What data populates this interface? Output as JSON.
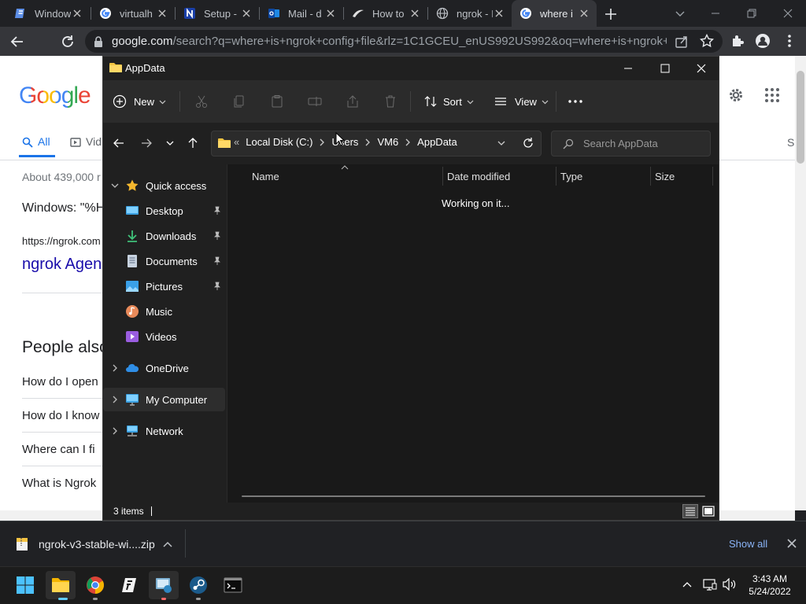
{
  "browser": {
    "tabs": [
      {
        "title": "Window",
        "favicon": "edge-doc-icon"
      },
      {
        "title": "virtualh",
        "favicon": "google-icon"
      },
      {
        "title": "Setup -",
        "favicon": "notion-icon"
      },
      {
        "title": "Mail - d",
        "favicon": "outlook-icon"
      },
      {
        "title": "How to",
        "favicon": "swoosh-icon"
      },
      {
        "title": "ngrok - I",
        "favicon": "globe-icon"
      },
      {
        "title": "where i",
        "favicon": "google-icon"
      }
    ],
    "url_host": "google.com",
    "url_path": "/search?q=where+is+ngrok+config+file&rlz=1C1GCEU_enUS992US992&oq=where+is+ngrok+conf..."
  },
  "google": {
    "logo": "Google",
    "tab_all": "All",
    "tab_videos": "Vid",
    "results_count": "About 439,000 r",
    "snippet_windows": "Windows: \"%H",
    "result_url": "https://ngrok.com",
    "result_title": "ngrok Agen",
    "people_also": "People also",
    "questions": [
      "How do I open",
      "How do I know",
      "Where can I fi",
      "What is Ngrok"
    ],
    "right_letter": "S"
  },
  "explorer": {
    "title": "AppData",
    "cmd": {
      "new": "New",
      "sort": "Sort",
      "view": "View"
    },
    "breadcrumb": {
      "overflow": "«",
      "segments": [
        "Local Disk (C:)",
        "Users",
        "VM6",
        "AppData"
      ]
    },
    "search_placeholder": "Search AppData",
    "columns": {
      "name": "Name",
      "date": "Date modified",
      "type": "Type",
      "size": "Size"
    },
    "loading": "Working on it...",
    "nav": {
      "quick_access": "Quick access",
      "items": [
        "Desktop",
        "Downloads",
        "Documents",
        "Pictures",
        "Music",
        "Videos"
      ],
      "onedrive": "OneDrive",
      "mycomputer": "My Computer",
      "network": "Network"
    },
    "status": "3 items"
  },
  "download": {
    "file": "ngrok-v3-stable-wi....zip",
    "show_all": "Show all"
  },
  "taskbar": {
    "time": "3:43 AM",
    "date": "5/24/2022"
  },
  "colors": {
    "chrome_dark": "#202124",
    "chrome_toolbar": "#35363a",
    "explorer_bg": "#191919",
    "accent": "#8ab4f8",
    "google_blue": "#4285f4",
    "google_red": "#ea4335",
    "google_yellow": "#fbbc05",
    "google_green": "#34a853"
  }
}
